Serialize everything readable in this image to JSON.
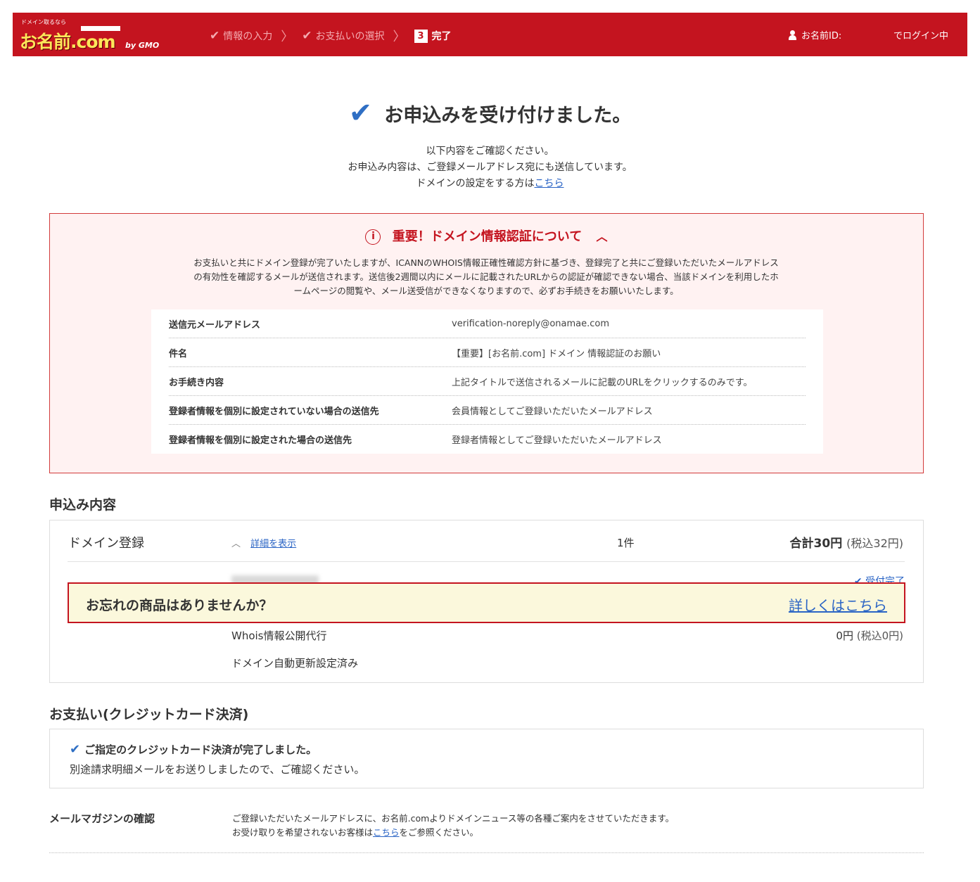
{
  "header": {
    "logo_tag": "ドメイン取るなら",
    "logo_text": "お名前.com",
    "logo_by": "by GMO",
    "steps": [
      {
        "label": "情報の入力",
        "state": "done"
      },
      {
        "label": "お支払いの選択",
        "state": "done"
      },
      {
        "label": "完了",
        "num": "3",
        "state": "current"
      }
    ],
    "user_id_label": "お名前ID:",
    "login_status": "でログイン中",
    "bg_color": "#c4141f"
  },
  "title": "お申込みを受け付けました。",
  "intro": {
    "line1": "以下内容をご確認ください。",
    "line2": "お申込み内容は、ご登録メールアドレス宛にも送信しています。",
    "line3_prefix": "ドメインの設定をする方は",
    "line3_link": "こちら"
  },
  "notice": {
    "heading": "重要！ドメイン情報認証について",
    "body_line1": "お支払いと共にドメイン登録が完了いたしますが、ICANNのWHOIS情報正確性確認方針に基づき、登録完了と共にご登録いただいたメールアドレス",
    "body_line2": "の有効性を確認するメールが送信されます。送信後2週間以内にメールに記載されたURLからの認証が確認できない場合、当該ドメインを利用したホ",
    "body_line3": "ームページの閲覧や、メール送受信ができなくなりますので、必ずお手続きをお願いいたします。",
    "rows": [
      {
        "key": "送信元メールアドレス",
        "value": "verification-noreply@onamae.com"
      },
      {
        "key": "件名",
        "value": "【重要】[お名前.com] ドメイン 情報認証のお願い"
      },
      {
        "key": "お手続き内容",
        "value": "上記タイトルで送信されるメールに記載のURLをクリックするのみです。"
      },
      {
        "key": "登録者情報を個別に設定されていない場合の送信先",
        "value": "会員情報としてご登録いただいたメールアドレス"
      },
      {
        "key": "登録者情報を個別に設定された場合の送信先",
        "value": "登録者情報としてご登録いただいたメールアドレス"
      }
    ]
  },
  "order": {
    "heading": "申込み内容",
    "domain_label": "ドメイン登録",
    "detail_link": "詳細を表示",
    "count": "1件",
    "total": "合計30円",
    "total_tax": "(税込32円)",
    "received": "受付完了",
    "whois": "Whois情報公開代行",
    "whois_price": "0円",
    "whois_tax": "(税込0円)",
    "auto_renew": "ドメイン自動更新設定済み"
  },
  "reminder": {
    "text": "お忘れの商品はありませんか？",
    "link": "詳しくはこちら"
  },
  "payment": {
    "heading": "お支払い(クレジットカード決済)",
    "status": "ご指定のクレジットカード決済が完了しました。",
    "note": "別途請求明細メールをお送りしましたので、ご確認ください。"
  },
  "mail_magazine": {
    "label": "メールマガジンの確認",
    "line1": "ご登録いただいたメールアドレスに、お名前.comよりドメインニュース等の各種ご案内をさせていただきます。",
    "line2_prefix": "お受け取りを希望されないお客様は",
    "line2_link": "こちら",
    "line2_suffix": "をご参照ください。"
  }
}
